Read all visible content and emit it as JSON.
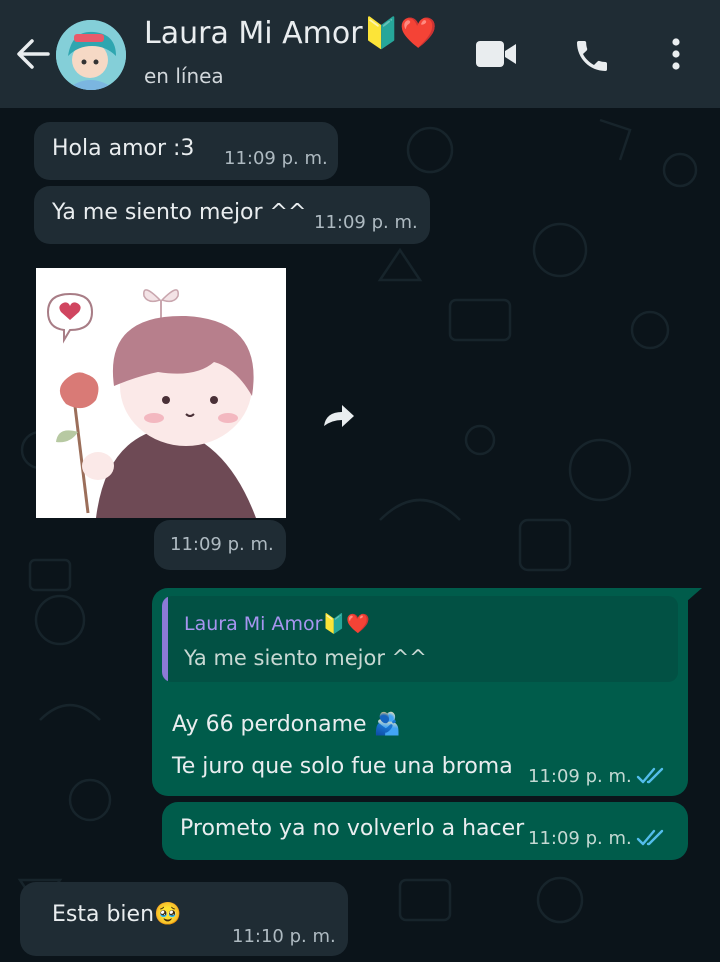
{
  "header": {
    "contact_name": "Laura Mi Amor🔰❤️",
    "status": "en línea"
  },
  "messages": [
    {
      "direction": "in",
      "text": "Hola amor :3",
      "time": "11:09 p. m."
    },
    {
      "direction": "in",
      "text": "Ya me siento mejor ^^",
      "time": "11:09 p. m."
    },
    {
      "direction": "in",
      "type": "sticker",
      "time": "11:09 p. m."
    },
    {
      "direction": "out",
      "quote_author": "Laura Mi Amor🔰❤️",
      "quote_text": "Ya me siento mejor ^^",
      "line1": "Ay 66 perdoname 🫂",
      "line2": "Te juro que solo fue una broma",
      "time": "11:09 p. m.",
      "status": "read"
    },
    {
      "direction": "out",
      "text": "Prometo ya no volverlo a hacer",
      "time": "11:09 p. m.",
      "status": "read"
    },
    {
      "direction": "in",
      "text": "Esta bien🥹",
      "time": "11:10 p. m."
    }
  ],
  "colors": {
    "background": "#0b141a",
    "header": "#1f2c34",
    "incoming": "#1f2c34",
    "outgoing": "#005c4b",
    "read_ticks": "#53bdeb"
  }
}
